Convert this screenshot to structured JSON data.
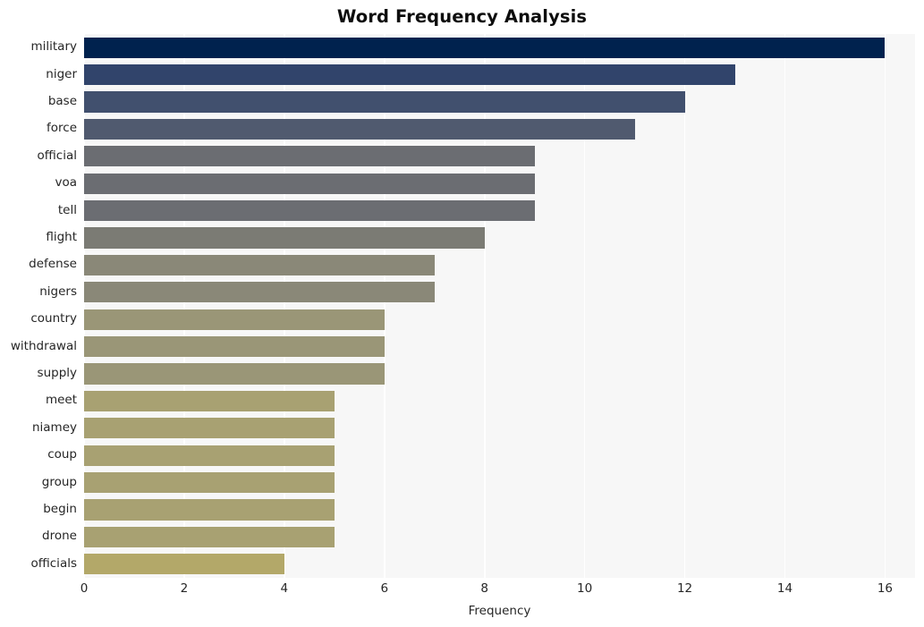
{
  "chart_data": {
    "type": "bar",
    "orientation": "horizontal",
    "title": "Word Frequency Analysis",
    "xlabel": "Frequency",
    "ylabel": "",
    "categories": [
      "military",
      "niger",
      "base",
      "force",
      "official",
      "voa",
      "tell",
      "flight",
      "defense",
      "nigers",
      "country",
      "withdrawal",
      "supply",
      "meet",
      "niamey",
      "coup",
      "group",
      "begin",
      "drone",
      "officials"
    ],
    "values": [
      16,
      13,
      12,
      11,
      9,
      9,
      9,
      8,
      7,
      7,
      6,
      6,
      6,
      5,
      5,
      5,
      5,
      5,
      5,
      4
    ],
    "xlim": [
      0,
      16.6
    ],
    "xticks": [
      0,
      2,
      4,
      6,
      8,
      10,
      12,
      14,
      16
    ],
    "xtick_labels": [
      "0",
      "2",
      "4",
      "6",
      "8",
      "10",
      "12",
      "14",
      "16"
    ],
    "grid": true,
    "grid_color": "#ffffff",
    "legend": null,
    "colormap": "cividis",
    "bar_colors": [
      "#00224e",
      "#31446b",
      "#41506e",
      "#505a6f",
      "#6b6d72",
      "#6b6d72",
      "#6b6d72",
      "#7b7b74",
      "#8a8878",
      "#8a8878",
      "#9a9677",
      "#9a9677",
      "#9a9677",
      "#a8a172",
      "#a8a172",
      "#a8a172",
      "#a8a172",
      "#a8a172",
      "#a8a172",
      "#b3a869"
    ],
    "plot_background": "#f7f7f7",
    "figure_background": "#ffffff",
    "title_color": "#0d0d0d",
    "tick_color": "#262626"
  }
}
